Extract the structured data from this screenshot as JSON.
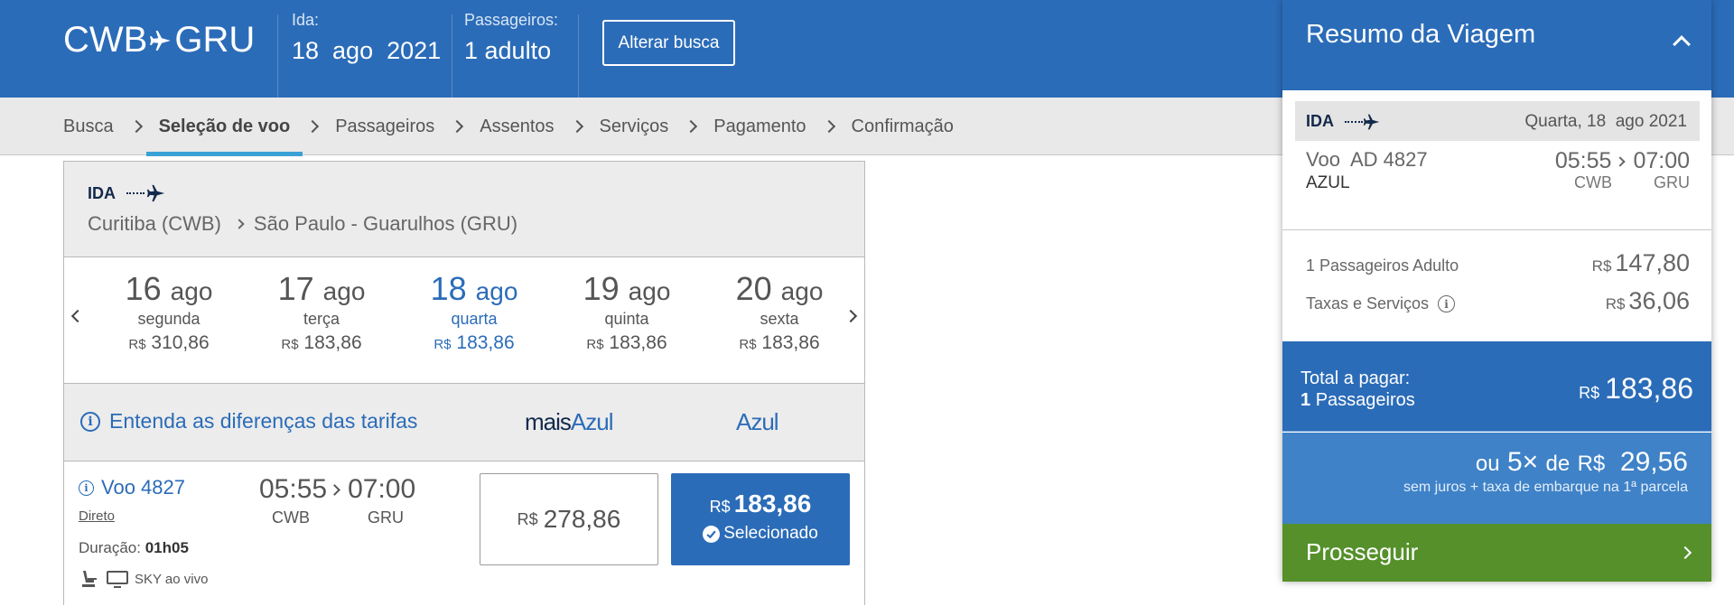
{
  "header": {
    "origin": "CWB",
    "destination": "GRU",
    "ida_label": "Ida:",
    "ida_value": "18  ago  2021",
    "pass_label": "Passageiros:",
    "pass_value": "1 adulto",
    "alter_button": "Alterar busca"
  },
  "steps": [
    "Busca",
    "Seleção de voo",
    "Passageiros",
    "Assentos",
    "Serviços",
    "Pagamento",
    "Confirmação"
  ],
  "active_step": "Seleção de voo",
  "leg": {
    "label": "IDA",
    "from": "Curitiba (CWB)",
    "to": "São Paulo - Guarulhos (GRU)"
  },
  "dates": [
    {
      "day": "16",
      "month": "ago",
      "weekday": "segunda",
      "currency": "R$",
      "price": "310,86",
      "selected": false
    },
    {
      "day": "17",
      "month": "ago",
      "weekday": "terça",
      "currency": "R$",
      "price": "183,86",
      "selected": false
    },
    {
      "day": "18",
      "month": "ago",
      "weekday": "quarta",
      "currency": "R$",
      "price": "183,86",
      "selected": true
    },
    {
      "day": "19",
      "month": "ago",
      "weekday": "quinta",
      "currency": "R$",
      "price": "183,86",
      "selected": false
    },
    {
      "day": "20",
      "month": "ago",
      "weekday": "sexta",
      "currency": "R$",
      "price": "183,86",
      "selected": false
    }
  ],
  "fares_header": {
    "info_link": "Entenda as diferenças das tarifas",
    "col1_prefix": "mais",
    "col1_brand": "Azul",
    "col2": "Azul"
  },
  "flight": {
    "number": "Voo 4827",
    "type": "Direto",
    "duration_label": "Duração:",
    "duration": "01h05",
    "amenity": "SKY ao vivo",
    "dep_time": "05:55",
    "arr_time": "07:00",
    "dep_code": "CWB",
    "arr_code": "GRU",
    "fare1_currency": "R$",
    "fare1_price": "278,86",
    "fare2_currency": "R$",
    "fare2_price": "183,86",
    "fare2_status": "Selecionado"
  },
  "summary": {
    "title": "Resumo da Viagem",
    "leg_label": "IDA",
    "leg_date": "Quarta, 18  ago 2021",
    "flight": "Voo  AD 4827",
    "airline": "AZUL",
    "dep_time": "05:55",
    "arr_time": "07:00",
    "dep_code": "CWB",
    "arr_code": "GRU",
    "passengers_label": "1 Passageiros Adulto",
    "passengers_currency": "R$",
    "passengers_price": "147,80",
    "taxes_label": "Taxas e Serviços",
    "taxes_currency": "R$",
    "taxes_price": "36,06",
    "total_label": "Total a pagar:",
    "total_pax_count": "1",
    "total_pax_label": "Passageiros",
    "total_currency": "R$",
    "total_price": "183,86",
    "installments_prefix": "ou",
    "installments_count": "5×",
    "installments_de": "de",
    "installments_currency": "R$",
    "installments_price": "29,56",
    "installments_note": "sem juros + taxa de embarque na 1ª parcela",
    "proceed": "Prosseguir"
  },
  "colors": {
    "brand_blue": "#2b6cb8",
    "navy": "#13294b",
    "green": "#55902b",
    "tab_underline": "#3aa1d6"
  }
}
